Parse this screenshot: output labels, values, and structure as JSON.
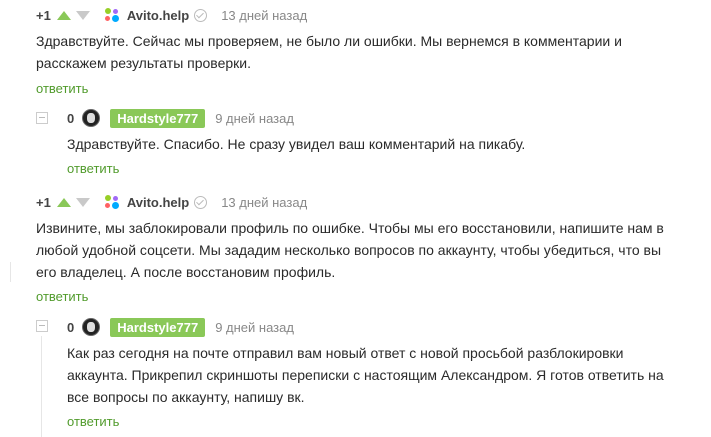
{
  "comments": [
    {
      "rating": "+1",
      "author": "Avito.help",
      "date": "13 дней назад",
      "text_lines": [
        "Здравствуйте. Сейчас мы проверяем, не было ли ошибки. Мы вернемся в комментарии и",
        "расскажем результаты проверки."
      ],
      "reply": "ответить"
    },
    {
      "rating": "0",
      "author": "Hardstyle777",
      "date": "9 дней назад",
      "text_lines": [
        "Здравствуйте. Спасибо. Не сразу увидел ваш комментарий на пикабу."
      ],
      "reply": "ответить"
    },
    {
      "rating": "+1",
      "author": "Avito.help",
      "date": "13 дней назад",
      "text_lines": [
        "Извините, мы заблокировали профиль по ошибке. Чтобы мы его восстановили, напишите нам в",
        "любой удобной соцсети. Мы зададим несколько вопросов по аккаунту, чтобы убедиться, что вы",
        "его владелец. А после восстановим профиль."
      ],
      "reply": "ответить"
    },
    {
      "rating": "0",
      "author": "Hardstyle777",
      "date": "9 дней назад",
      "text_lines": [
        "Как раз сегодня на почте отправил вам новый ответ с новой просьбой разблокировки",
        "аккаунта. Прикрепил скриншоты переписки с настоящим Александром. Я готов ответить на",
        "все вопросы по аккаунту, напишу вк."
      ],
      "reply": "ответить"
    }
  ]
}
